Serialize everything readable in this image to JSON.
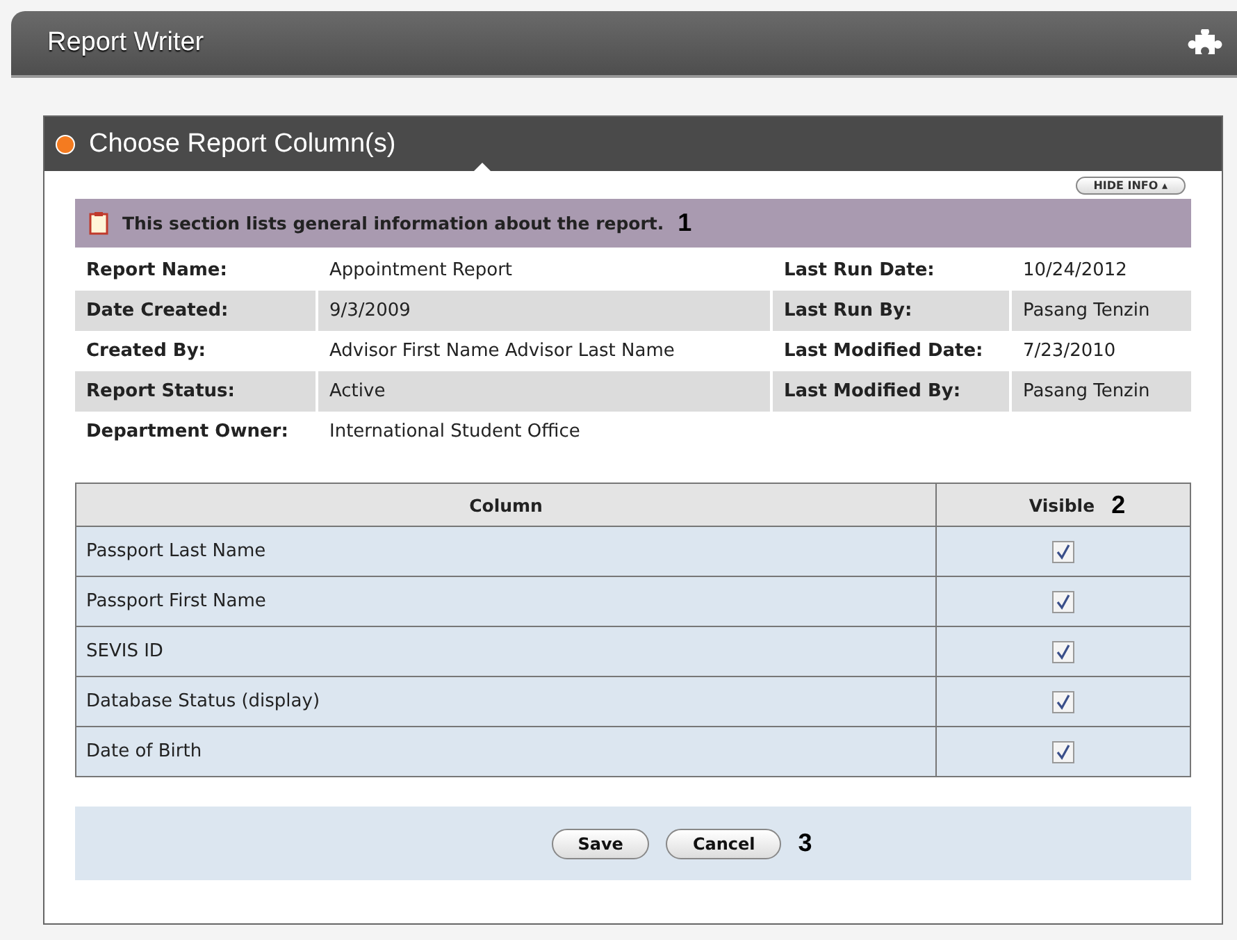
{
  "window": {
    "title": "Report Writer"
  },
  "panel": {
    "title": "Choose Report Column(s)",
    "hide_info_button": "HIDE INFO ▴",
    "info_banner": {
      "text": "This section lists general information about the report.",
      "callout": "1"
    },
    "info_rows": [
      {
        "label": "Report Name:",
        "value": "Appointment Report",
        "label_2": "Last Run Date:",
        "value_2": "10/24/2012"
      },
      {
        "label": "Date Created:",
        "value": "9/3/2009",
        "label_2": "Last Run By:",
        "value_2": "Pasang Tenzin"
      },
      {
        "label": "Created By:",
        "value": "Advisor First Name Advisor Last Name",
        "label_2": "Last Modified Date:",
        "value_2": "7/23/2010"
      },
      {
        "label": "Report Status:",
        "value": "Active",
        "label_2": "Last Modified By:",
        "value_2": "Pasang Tenzin"
      },
      {
        "label": "Department Owner:",
        "value": "International Student Office"
      }
    ],
    "table": {
      "columns": [
        "Column",
        "Visible"
      ],
      "header_callout": "2",
      "rows": [
        {
          "column": "Passport Last Name",
          "visible": true
        },
        {
          "column": "Passport First Name",
          "visible": true
        },
        {
          "column": "SEVIS ID",
          "visible": true
        },
        {
          "column": "Database Status (display)",
          "visible": true
        },
        {
          "column": "Date of Birth",
          "visible": true
        }
      ]
    },
    "buttons": [
      "Save",
      "Cancel"
    ],
    "buttons_callout": "3"
  }
}
